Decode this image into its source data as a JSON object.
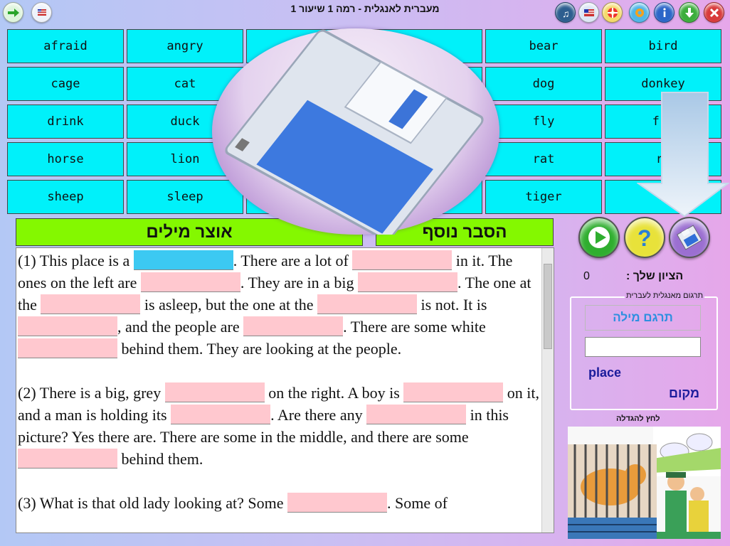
{
  "title": "מעברית לאנגלית -  רמה 1 שיעור 1",
  "toolbar_left": [
    {
      "name": "exit-arrow-icon"
    },
    {
      "name": "flag-globe-icon"
    }
  ],
  "toolbar_right": [
    {
      "name": "music-icon"
    },
    {
      "name": "us-flag-icon"
    },
    {
      "name": "lifebuoy-icon"
    },
    {
      "name": "settings-icon"
    },
    {
      "name": "info-icon"
    },
    {
      "name": "download-icon"
    },
    {
      "name": "close-icon"
    }
  ],
  "words": [
    [
      "afraid",
      "angry",
      "",
      "",
      "bear",
      "bird"
    ],
    [
      "cage",
      "cat",
      "",
      "",
      "dog",
      "donkey"
    ],
    [
      "drink",
      "duck",
      "",
      "",
      "fly",
      "fro"
    ],
    [
      "horse",
      "lion",
      "",
      "",
      "rat",
      "ri"
    ],
    [
      "sheep",
      "sleep",
      "",
      "",
      "tiger",
      "z"
    ]
  ],
  "headers": {
    "vocabulary": "אוצר מילים",
    "more_explanation": "הסבר נוסף"
  },
  "text": {
    "paragraphs": [
      [
        "(1)  This place is a ",
        "BLANK_ACTIVE",
        ". There are a lot of ",
        "BLANK",
        " in it. The ones on the left are ",
        "BLANK",
        ". They are in a big ",
        "BLANK",
        ". The one at the ",
        "BLANK",
        " is asleep, but the one at the ",
        "BLANK",
        " is not. It is ",
        "BLANK",
        ", and the people are ",
        "BLANK",
        ". There are some white ",
        "BLANK",
        " behind them. They are looking at the people."
      ],
      [
        "(2)  There is a big, grey ",
        "BLANK",
        " on the right. A boy is ",
        "BLANK",
        " on it, and a man is holding its ",
        "BLANK",
        ". Are there any ",
        "BLANK",
        " in this picture? Yes there are. There are some in the middle, and there are some ",
        "BLANK",
        " behind them."
      ],
      [
        "(3)  What is that old lady looking at? Some ",
        "BLANK",
        ". Some of"
      ]
    ]
  },
  "score": {
    "label": "הציון שלך :",
    "value": "0"
  },
  "translation": {
    "legend": "תרגום מאנגלית לעברית",
    "button": "תרגם מילה",
    "input_value": "",
    "english_word": "place",
    "hebrew_word": "מקום"
  },
  "zoom_label": "לחץ להגדלה"
}
